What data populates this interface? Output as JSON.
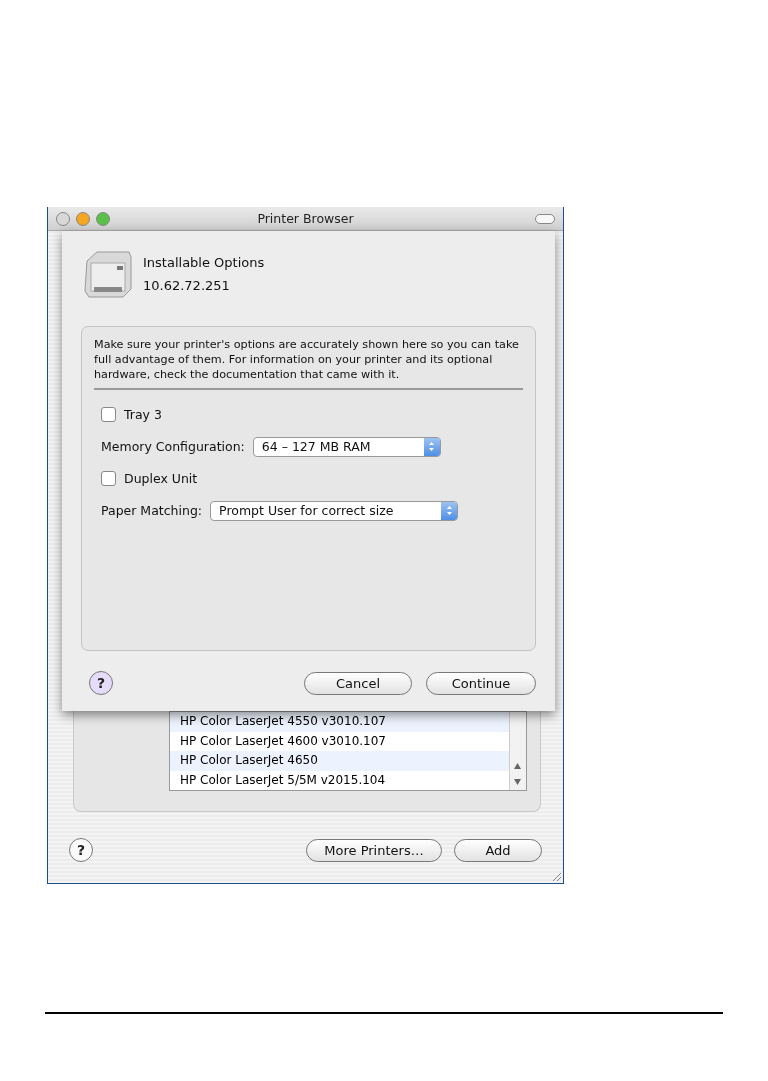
{
  "window": {
    "title": "Printer Browser"
  },
  "sheet": {
    "title": "Installable Options",
    "address": "10.62.72.251",
    "description": "Make sure your printer's options are accurately shown here so you can take full advantage of them.  For information on your printer and its optional hardware, check the documentation that came with it.",
    "options": [
      {
        "kind": "checkbox",
        "label": "Tray 3",
        "checked": false
      },
      {
        "kind": "popup",
        "label": "Memory Configuration:",
        "value": "64 – 127 MB RAM"
      },
      {
        "kind": "checkbox",
        "label": "Duplex Unit",
        "checked": false
      },
      {
        "kind": "popup",
        "label": "Paper Matching:",
        "value": "Prompt User for correct size"
      }
    ],
    "help_button": "?",
    "buttons": [
      "Cancel",
      "Continue"
    ]
  },
  "printer_list": {
    "rows": [
      {
        "label": "HP Color LaserJet 4550 v3010.107"
      },
      {
        "label": "HP Color LaserJet 4600 v3010.107"
      },
      {
        "label": "HP Color LaserJet 4650"
      },
      {
        "label": "HP Color LaserJet 5/5M v2015.104"
      }
    ]
  },
  "help_button": "?",
  "buttons": [
    "More Printers…",
    "Add"
  ]
}
